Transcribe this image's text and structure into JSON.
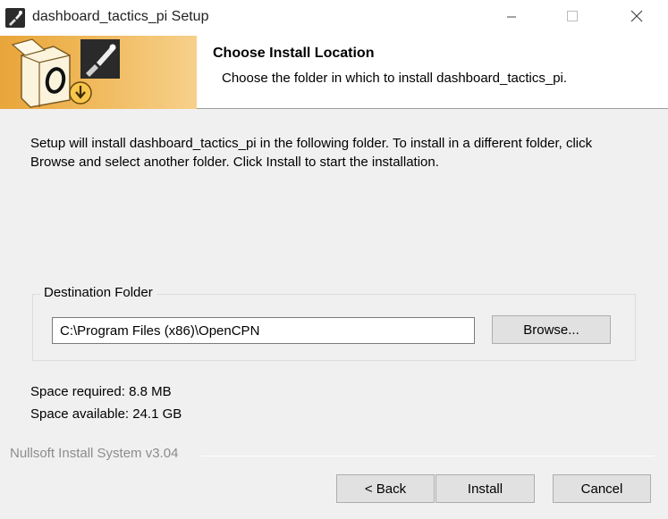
{
  "window": {
    "title": "dashboard_tactics_pi Setup",
    "controls": {
      "minimize": "minimize-icon",
      "maximize": "maximize-icon",
      "close": "close-icon"
    }
  },
  "header": {
    "title": "Choose Install Location",
    "subtitle": "Choose the folder in which to install dashboard_tactics_pi."
  },
  "body": {
    "intro": "Setup will install dashboard_tactics_pi in the following folder. To install in a different folder, click Browse and select another folder. Click Install to start the installation."
  },
  "destination": {
    "group_label": "Destination Folder",
    "path": "C:\\Program Files (x86)\\OpenCPN",
    "browse_label": "Browse..."
  },
  "space": {
    "required": "Space required: 8.8 MB",
    "available": "Space available: 24.1 GB"
  },
  "footer": {
    "brand": "Nullsoft Install System v3.04",
    "back_label": "< Back",
    "install_label": "Install",
    "cancel_label": "Cancel"
  },
  "colors": {
    "banner_accent": "#e8a53a",
    "button_face": "#e1e1e1",
    "dialog_bg": "#f0f0f0"
  }
}
